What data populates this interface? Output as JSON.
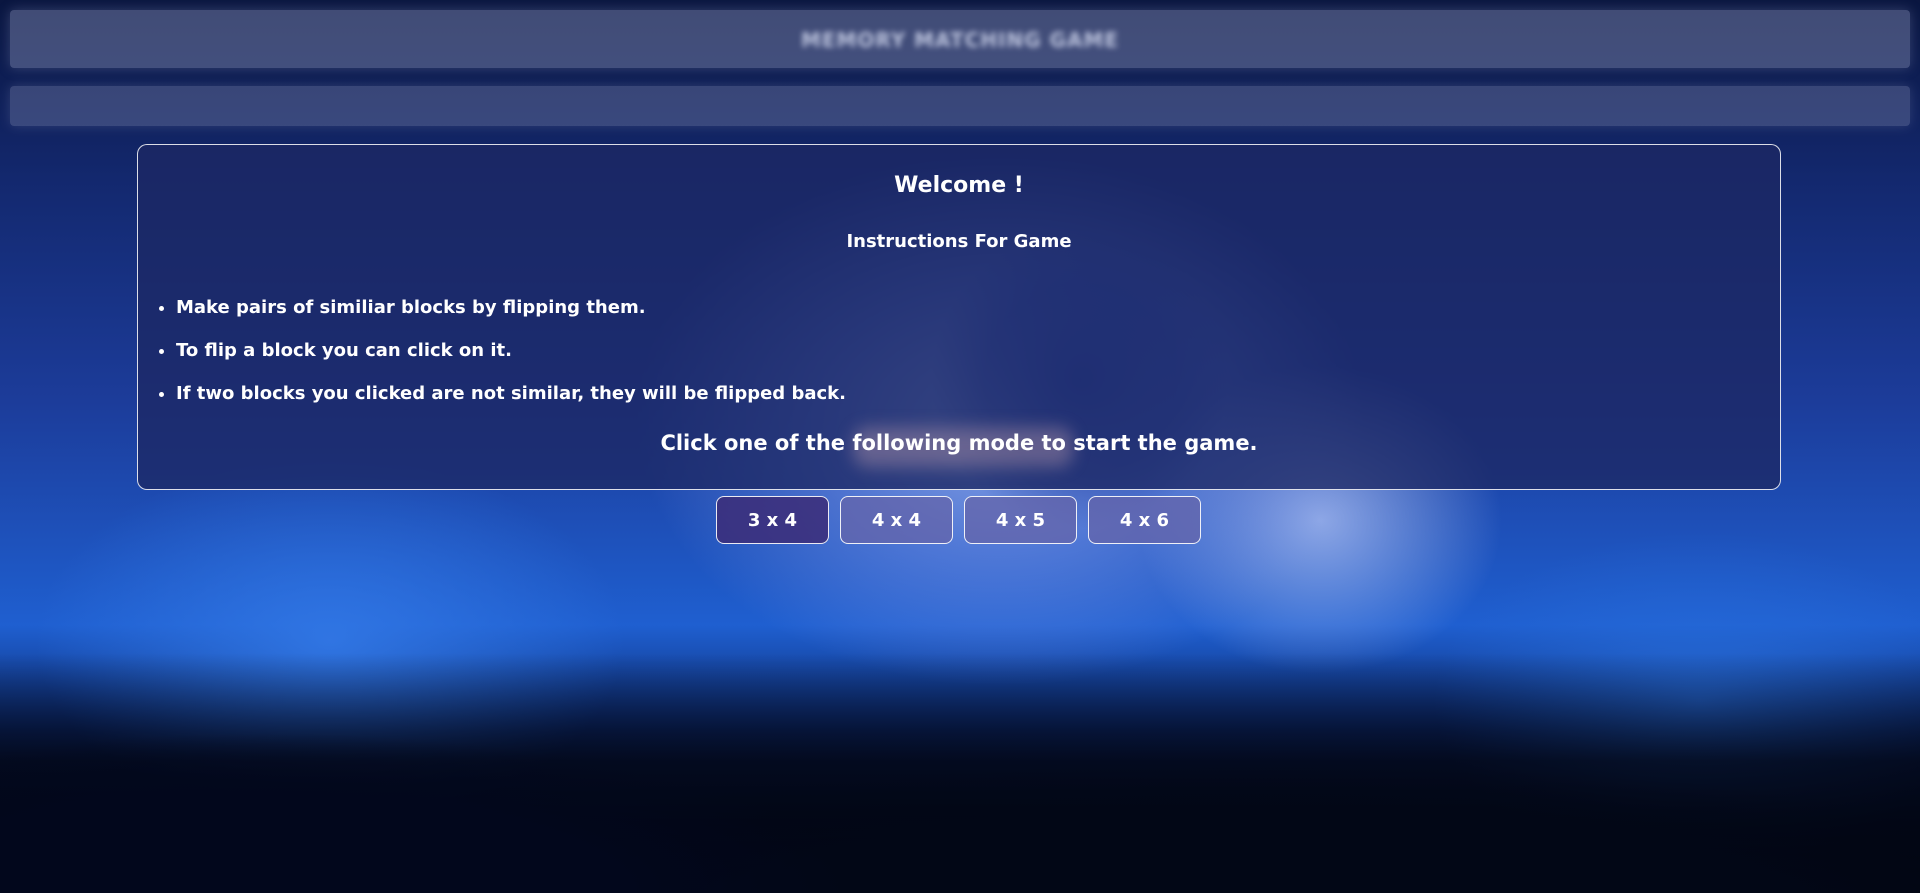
{
  "header": {
    "title": "MEMORY MATCHING GAME"
  },
  "panel": {
    "welcome": "Welcome !",
    "subtitle": "Instructions For Game",
    "instructions": [
      "Make pairs of similiar blocks by flipping them.",
      "To flip a block you can click on it.",
      "If two blocks you clicked are not similar, they will be flipped back."
    ],
    "prompt": "Click one of the following mode to start the game."
  },
  "modes": [
    {
      "label": "3 x 4",
      "active": true
    },
    {
      "label": "4 x 4",
      "active": false
    },
    {
      "label": "4 x 5",
      "active": false
    },
    {
      "label": "4 x 6",
      "active": false
    }
  ],
  "colors": {
    "panel_bg": "#1c2864",
    "button_bg": "#6464aa",
    "button_active_bg": "#3c2d78",
    "text": "#ffffff"
  }
}
